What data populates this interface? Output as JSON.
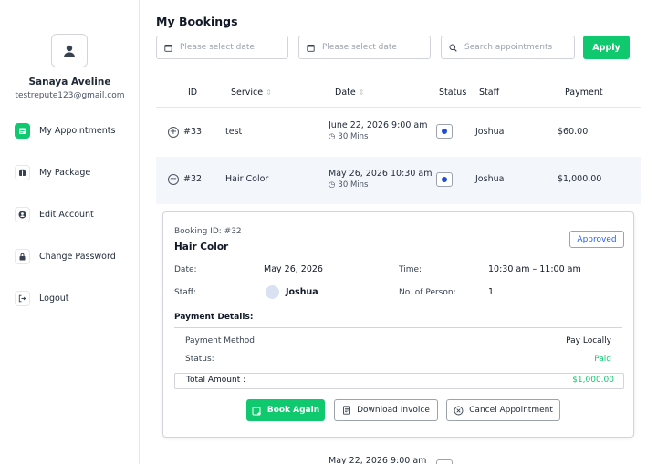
{
  "sidebar": {
    "user_name": "Sanaya Aveline",
    "user_email": "testrepute123@gmail.com",
    "items": [
      {
        "label": "My Appointments",
        "icon": "calendar-icon",
        "active": true
      },
      {
        "label": "My Package",
        "icon": "package-icon",
        "active": false
      },
      {
        "label": "Edit Account",
        "icon": "account-icon",
        "active": false
      },
      {
        "label": "Change Password",
        "icon": "lock-icon",
        "active": false
      },
      {
        "label": "Logout",
        "icon": "logout-icon",
        "active": false
      }
    ]
  },
  "header": {
    "title": "My Bookings",
    "date_from_placeholder": "Please select date",
    "date_to_placeholder": "Please select date",
    "search_placeholder": "Search appointments",
    "apply_label": "Apply"
  },
  "table": {
    "columns": [
      "ID",
      "Service",
      "Date",
      "Status",
      "Staff",
      "Payment"
    ],
    "rows": [
      {
        "id": "#33",
        "service": "test",
        "date": "June 22, 2026 9:00 am",
        "duration": "30 Mins",
        "staff": "Joshua",
        "payment": "$60.00"
      },
      {
        "id": "#32",
        "service": "Hair Color",
        "date": "May 26, 2026 10:30 am",
        "duration": "30 Mins",
        "staff": "Joshua",
        "payment": "$1,000.00"
      }
    ],
    "partial_row_date": "May 22, 2026 9:00 am"
  },
  "detail": {
    "booking_id": "Booking ID: #32",
    "service": "Hair Color",
    "status_badge": "Approved",
    "date_label": "Date:",
    "date_value": "May 26, 2026",
    "time_label": "Time:",
    "time_value": "10:30 am – 11:00 am",
    "staff_label": "Staff:",
    "staff_value": "Joshua",
    "persons_label": "No. of Person:",
    "persons_value": "1",
    "payment_details_title": "Payment Details:",
    "payment_method_label": "Payment Method:",
    "payment_method_value": "Pay Locally",
    "status_label": "Status:",
    "status_value": "Paid",
    "total_label": "Total Amount :",
    "total_value": "$1,000.00",
    "book_again_label": "Book Again",
    "download_invoice_label": "Download Invoice",
    "cancel_label": "Cancel Appointment"
  },
  "colors": {
    "accent": "#10c96f",
    "link_blue": "#2563eb",
    "status_dot": "#1d4ed8",
    "expanded_row_bg": "#f3f6fa"
  }
}
